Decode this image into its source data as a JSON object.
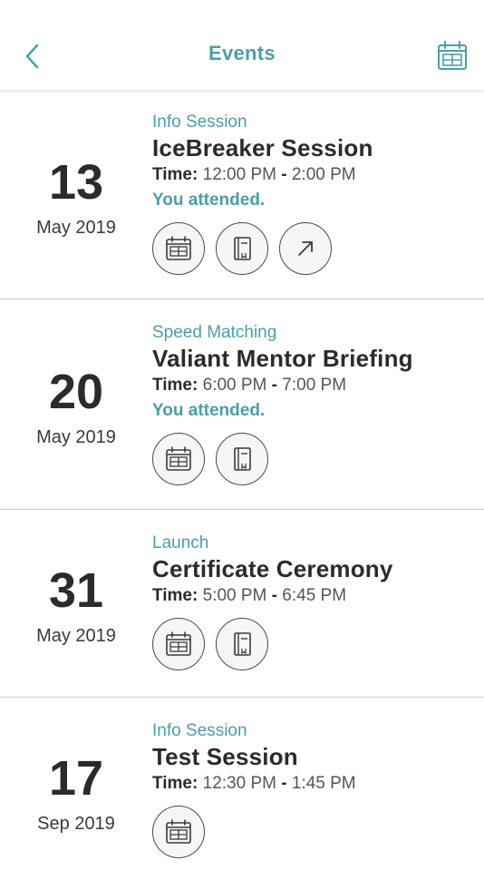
{
  "header": {
    "title": "Events",
    "back_icon": "chevron-left-icon",
    "calendar_icon": "calendar-icon",
    "accent_color": "#4a9fa8"
  },
  "events": [
    {
      "category": "Info Session",
      "title": "IceBreaker Session",
      "day": "13",
      "month_year": "May 2019",
      "time_label": "Time:",
      "start": "12:00 PM",
      "end": "2:00 PM",
      "status": "You attended.",
      "actions": [
        "calendar-icon",
        "notebook-icon",
        "external-link-icon"
      ]
    },
    {
      "category": "Speed Matching",
      "title": "Valiant Mentor Briefing",
      "day": "20",
      "month_year": "May 2019",
      "time_label": "Time:",
      "start": "6:00 PM",
      "end": "7:00 PM",
      "status": "You attended.",
      "actions": [
        "calendar-icon",
        "notebook-icon"
      ]
    },
    {
      "category": "Launch",
      "title": "Certificate Ceremony",
      "day": "31",
      "month_year": "May 2019",
      "time_label": "Time:",
      "start": "5:00 PM",
      "end": "6:45 PM",
      "status": "",
      "actions": [
        "calendar-icon",
        "notebook-icon"
      ]
    },
    {
      "category": "Info Session",
      "title": "Test Session",
      "day": "17",
      "month_year": "Sep 2019",
      "time_label": "Time:",
      "start": "12:30 PM",
      "end": "1:45 PM",
      "status": "",
      "actions": [
        "calendar-icon"
      ]
    }
  ]
}
